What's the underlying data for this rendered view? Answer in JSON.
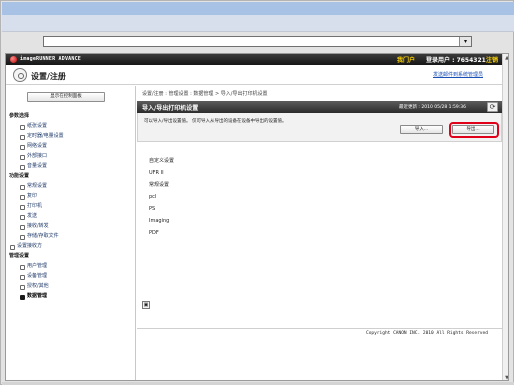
{
  "browser": {
    "address_dropdown_glyph": "▾"
  },
  "brand_bar": {
    "product_name": "imageRUNNER ADVANCE",
    "portal_label": "我门户",
    "login_user_text": "登录用户 : 7654321",
    "logout_label": "注销"
  },
  "header": {
    "title": "设置/注册",
    "send_error_link": "发送邮件到系统管理员"
  },
  "sidebar": {
    "main_panel_button": "显示在控制面板",
    "items": [
      {
        "label": "参数选择",
        "type": "section"
      },
      {
        "label": "纸张设置",
        "type": "item"
      },
      {
        "label": "定时器/电量设置",
        "type": "item"
      },
      {
        "label": "网络设置",
        "type": "item"
      },
      {
        "label": "外部接口",
        "type": "item"
      },
      {
        "label": "音量设置",
        "type": "item"
      },
      {
        "label": "功能设置",
        "type": "section"
      },
      {
        "label": "常规设置",
        "type": "item"
      },
      {
        "label": "复印",
        "type": "item"
      },
      {
        "label": "打印机",
        "type": "item"
      },
      {
        "label": "发送",
        "type": "item"
      },
      {
        "label": "接收/转发",
        "type": "item"
      },
      {
        "label": "存储/存取文件",
        "type": "item"
      },
      {
        "label": "设置接收方",
        "type": "top"
      },
      {
        "label": "管理设置",
        "type": "section"
      },
      {
        "label": "用户管理",
        "type": "item"
      },
      {
        "label": "设备管理",
        "type": "item"
      },
      {
        "label": "授权/其他",
        "type": "item"
      },
      {
        "label": "数据管理",
        "type": "active"
      }
    ]
  },
  "content": {
    "breadcrumb": "设置/注册 : 管理设置 : 数据管理 > 导入/导出打印机设置",
    "panel_title": "导入/导出打印机设置",
    "last_updated": "最近更新 : 2010 05/28 1:59:36",
    "refresh_glyph": "⟳",
    "info_text": "可以导入/导出设置值。 仅可导入从导出的设备在设备中导出的设置值。",
    "import_button": "导入...",
    "export_button": "导出...",
    "settings": [
      "自定义设置",
      "UFR II",
      "常规设置",
      "pcl",
      "PS",
      "Imaging",
      "PDF"
    ],
    "print_icon_glyph": "▣"
  },
  "footer": {
    "copyright": "Copyright CANON INC. 2010 All Rights Reserved"
  },
  "scrollbar": {
    "up_glyph": "▲",
    "down_glyph": "▼"
  }
}
